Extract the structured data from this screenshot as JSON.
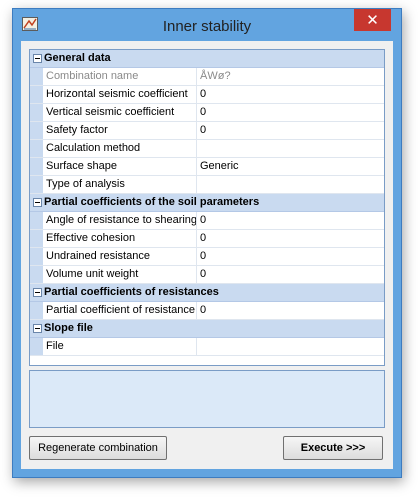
{
  "window": {
    "title": "Inner stability"
  },
  "grid": {
    "categories": [
      {
        "label": "General data",
        "rows": [
          {
            "name": "Combination name",
            "value": "ÅWø?",
            "disabled": true
          },
          {
            "name": "Horizontal seismic coefficient",
            "value": "0"
          },
          {
            "name": "Vertical seismic coefficient",
            "value": "0"
          },
          {
            "name": "Safety factor",
            "value": "0"
          },
          {
            "name": "Calculation method",
            "value": ""
          },
          {
            "name": "Surface shape",
            "value": "Generic"
          },
          {
            "name": "Type of analysis",
            "value": ""
          }
        ]
      },
      {
        "label": "Partial coefficients of the soil parameters",
        "rows": [
          {
            "name": "Angle of resistance to shearing st",
            "value": "0"
          },
          {
            "name": "Effective cohesion",
            "value": "0"
          },
          {
            "name": "Undrained resistance",
            "value": "0"
          },
          {
            "name": "Volume unit weight",
            "value": "0"
          }
        ]
      },
      {
        "label": "Partial coefficients of resistances",
        "rows": [
          {
            "name": "Partial coefficient of resistance",
            "value": "0"
          }
        ]
      },
      {
        "label": "Slope file",
        "rows": [
          {
            "name": "File",
            "value": ""
          }
        ]
      }
    ]
  },
  "buttons": {
    "regenerate": "Regenerate combination",
    "execute": "Execute >>>"
  },
  "icons": {
    "app": "app-icon",
    "close": "close-icon"
  },
  "colors": {
    "titlebar": "#62a4e0",
    "category": "#c9daf0",
    "close": "#c7372f",
    "description": "#dbe9f8"
  }
}
